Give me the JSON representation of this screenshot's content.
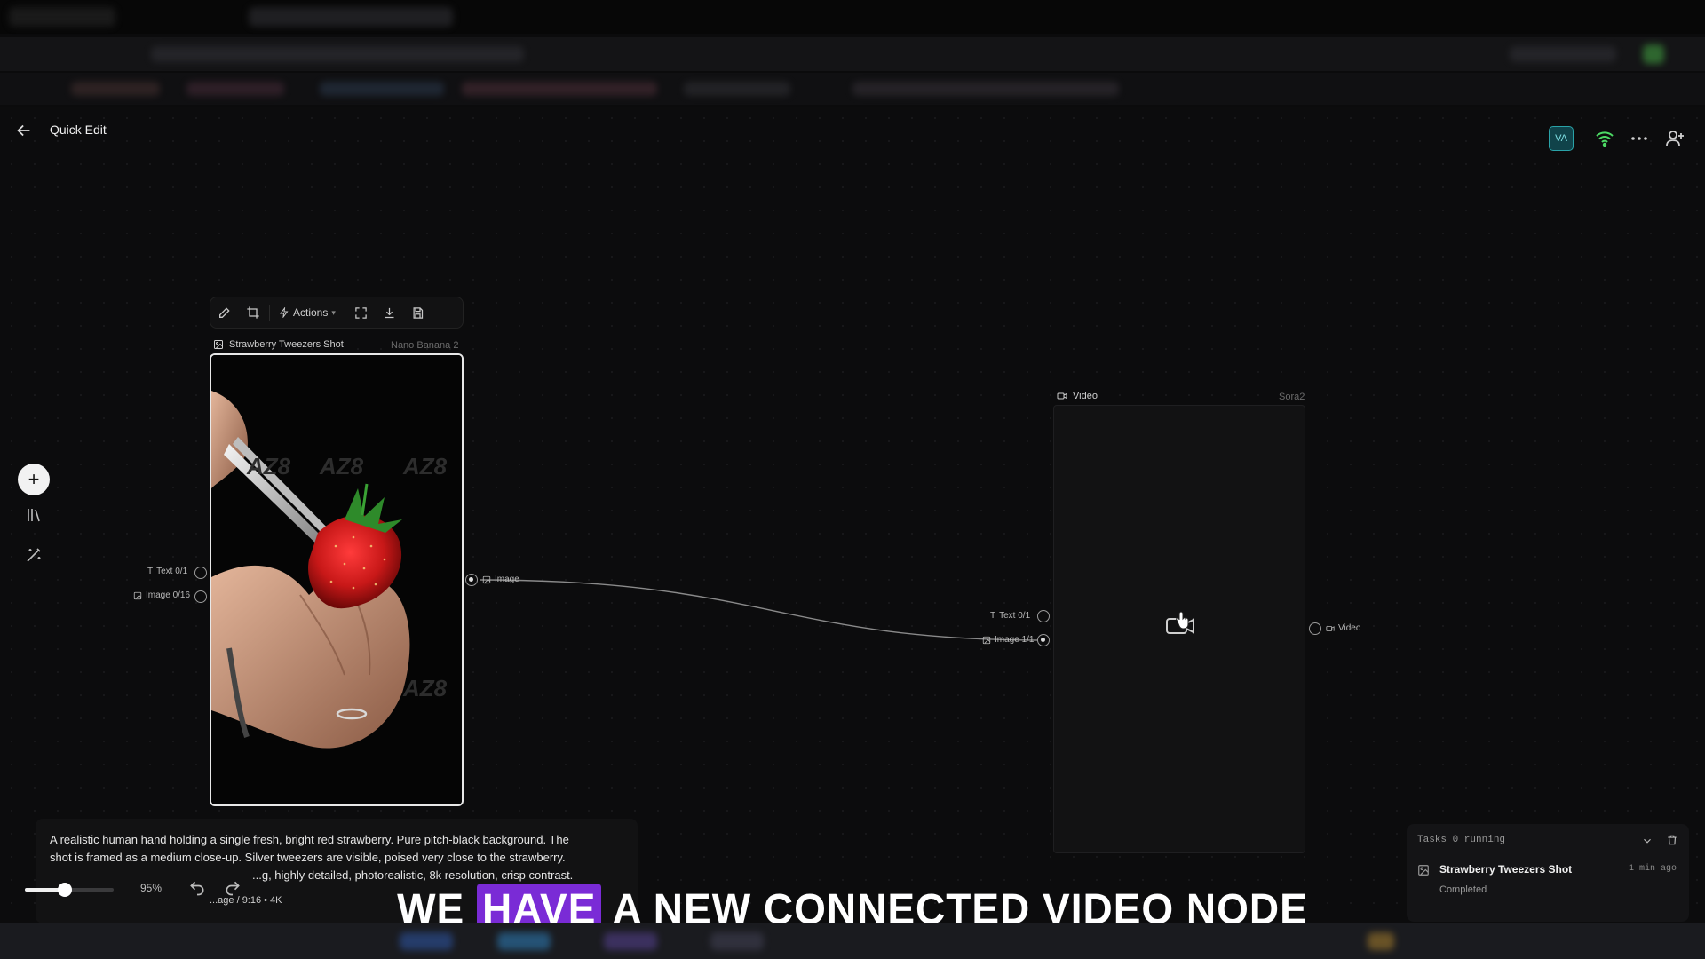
{
  "app": {
    "title": "Quick Edit",
    "avatar_initials": "VA"
  },
  "image_node": {
    "title": "Strawberry Tweezers Shot",
    "model": "Nano Banana 2",
    "toolbar": {
      "actions_label": "Actions"
    },
    "inputs": [
      {
        "label": "Text 0/1"
      },
      {
        "label": "Image 0/16"
      }
    ],
    "output": {
      "label": "Image"
    },
    "watermark": "AZ8"
  },
  "video_node": {
    "title": "Video",
    "model": "Sora2",
    "inputs": [
      {
        "label": "Text 0/1"
      },
      {
        "label": "Image 1/1"
      }
    ],
    "output": {
      "label": "Video"
    }
  },
  "prompt": {
    "line1": "A realistic human hand holding a single fresh, bright red strawberry. Pure pitch-black background. The",
    "line2": "shot is framed as a medium close-up. Silver tweezers are visible, poised very close to the strawberry.",
    "line3": "...g, highly detailed, photorealistic, 8k resolution, crisp contrast.",
    "meta": "...age  /  9:16  •  4K"
  },
  "zoom": {
    "value": 95,
    "label": "95%"
  },
  "tasks": {
    "header": "Tasks  0 running",
    "items": [
      {
        "title": "Strawberry Tweezers Shot",
        "status": "Completed",
        "time": "1 min ago"
      }
    ]
  },
  "subtitle": {
    "before": "WE",
    "highlight": "HAVE",
    "after": "A NEW CONNECTED VIDEO NODE"
  },
  "colors": {
    "accent": "#7a2bd6",
    "avatar": "#2aa3a8",
    "wifi": "#4cd964"
  }
}
